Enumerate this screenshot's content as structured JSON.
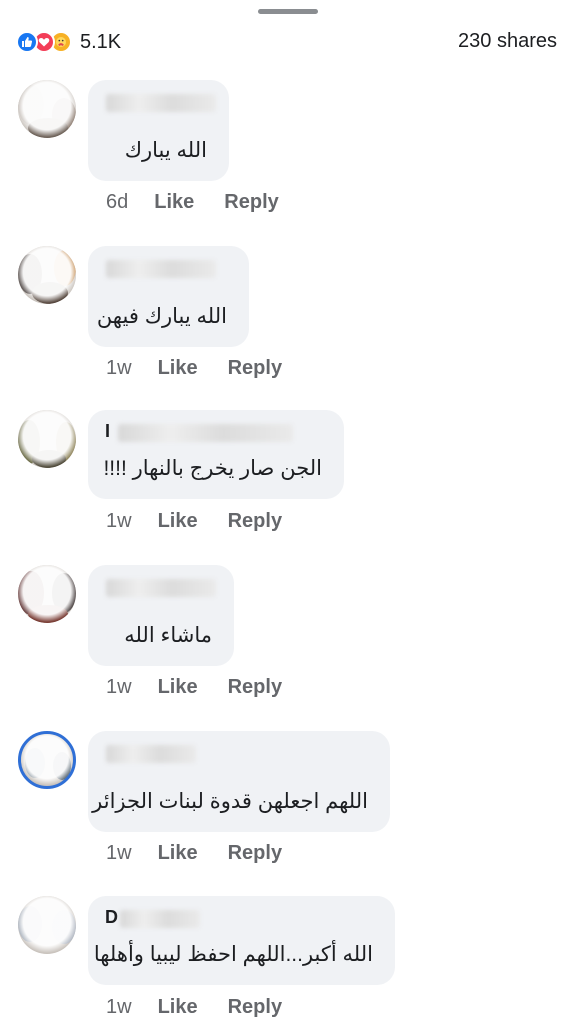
{
  "summary": {
    "reactions_count": "5.1K",
    "shares": "230 shares",
    "reaction_icons": [
      "like-icon",
      "love-icon",
      "care-icon"
    ]
  },
  "actions": {
    "like": "Like",
    "reply": "Reply"
  },
  "comments": [
    {
      "author_visible": "",
      "text": "الله يبارك",
      "time": "6d"
    },
    {
      "author_visible": "",
      "text": "الله يبارك فيهن",
      "time": "1w"
    },
    {
      "author_visible": "I",
      "text": "الجن صار يخرج بالنهار !!!!",
      "time": "1w"
    },
    {
      "author_visible": "",
      "text": "ماشاء الله",
      "time": "1w"
    },
    {
      "author_visible": "",
      "text": "اللهم اجعلهن قدوة لبنات الجزائر",
      "time": "1w"
    },
    {
      "author_visible": "D",
      "text": "الله أكبر...اللهم احفظ ليبيا وأهلها",
      "time": "1w"
    }
  ],
  "colors": {
    "accent": "#1877f2",
    "bubble": "#f0f2f5",
    "meta_text": "#65676b",
    "love": "#f33e58",
    "care": "#f7b125"
  }
}
